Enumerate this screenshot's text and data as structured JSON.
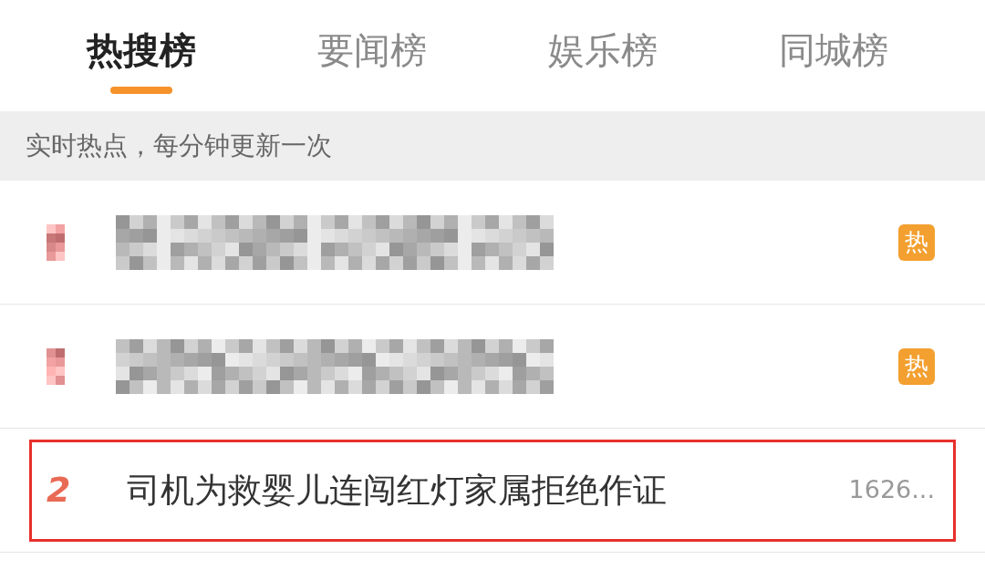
{
  "tabs": [
    {
      "label": "热搜榜",
      "selected": true
    },
    {
      "label": "要闻榜",
      "selected": false
    },
    {
      "label": "娱乐榜",
      "selected": false
    },
    {
      "label": "同城榜",
      "selected": false
    }
  ],
  "notice": "实时热点，每分钟更新一次",
  "rows": [
    {
      "kind": "pixelated",
      "badge": "热",
      "highlighted": false
    },
    {
      "kind": "pixelated",
      "badge": "热",
      "highlighted": false
    },
    {
      "kind": "text",
      "rank": "2",
      "title": "司机为救婴儿连闯红灯家属拒绝作证",
      "count": "1626...",
      "highlighted": true
    }
  ]
}
